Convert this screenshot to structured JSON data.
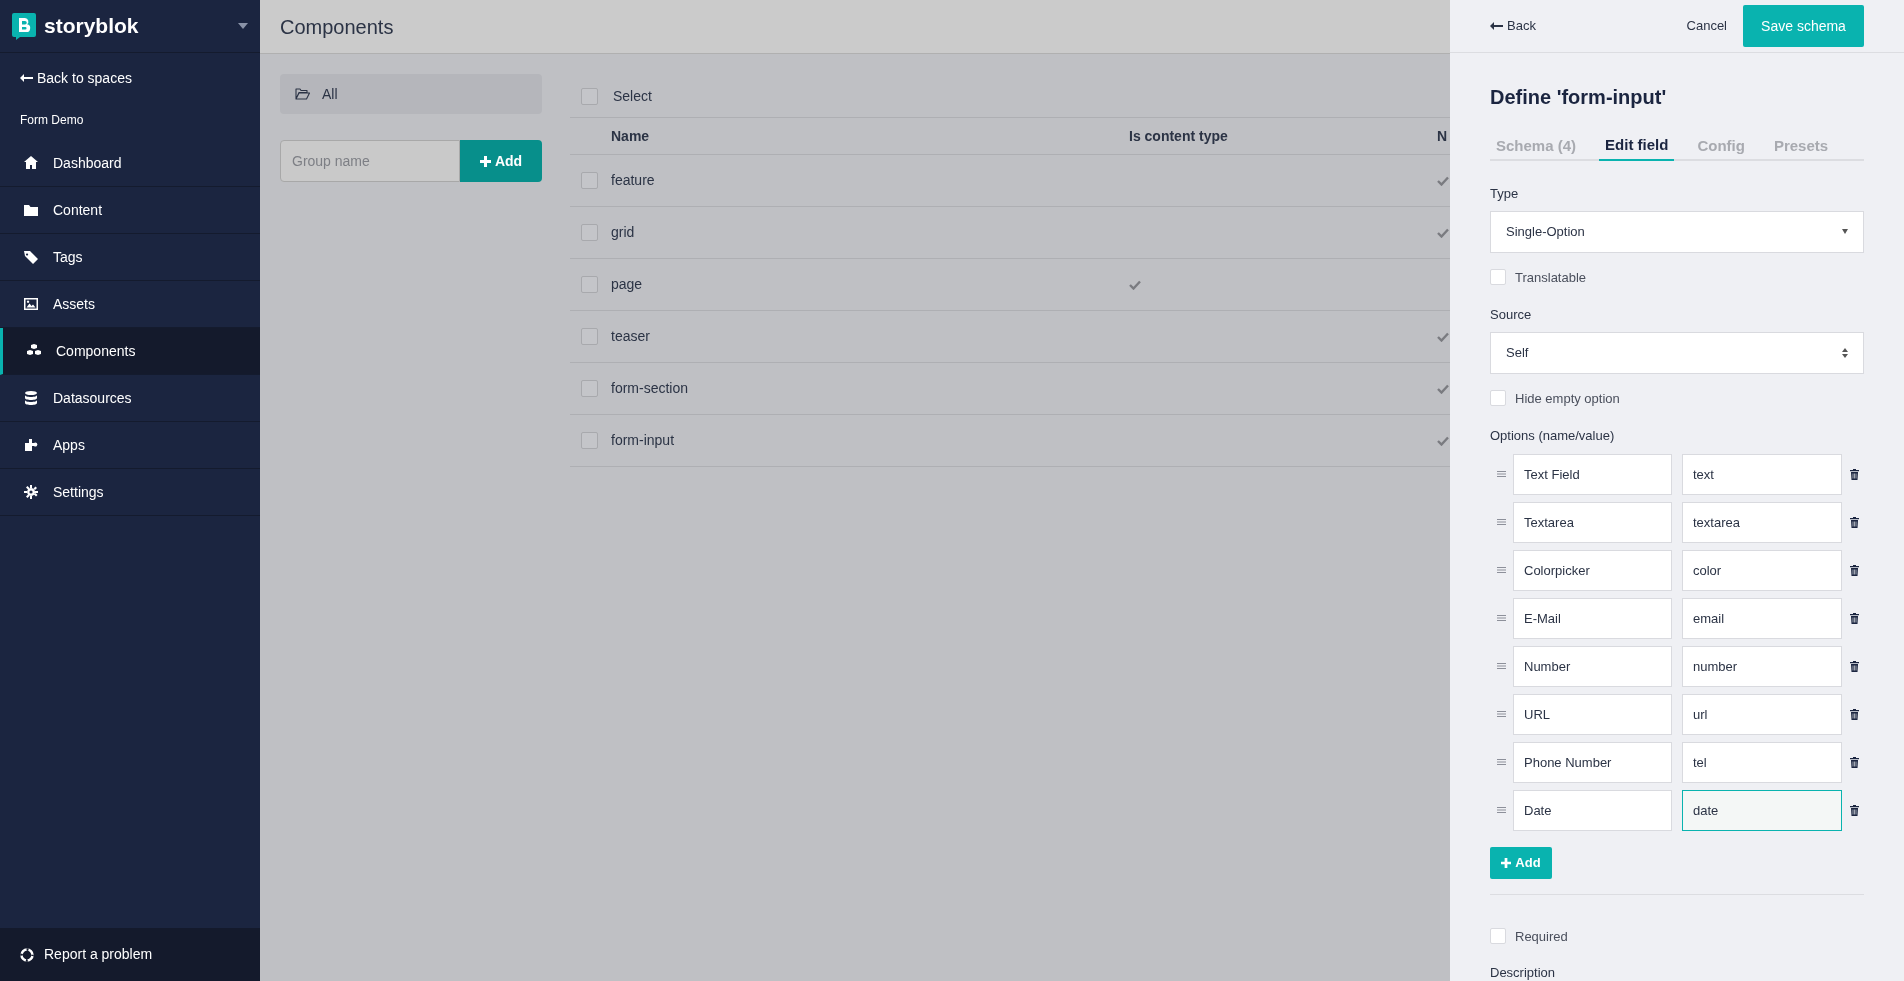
{
  "sidebar": {
    "brand": "storyblok",
    "back": "Back to spaces",
    "space": "Form Demo",
    "items": [
      {
        "label": "Dashboard",
        "selected": false
      },
      {
        "label": "Content",
        "selected": false
      },
      {
        "label": "Tags",
        "selected": false
      },
      {
        "label": "Assets",
        "selected": false
      },
      {
        "label": "Components",
        "selected": true
      },
      {
        "label": "Datasources",
        "selected": false
      },
      {
        "label": "Apps",
        "selected": false
      },
      {
        "label": "Settings",
        "selected": false
      }
    ],
    "footer": "Report a problem"
  },
  "main": {
    "title": "Components",
    "groups": [
      {
        "label": "All",
        "selected": true
      }
    ],
    "group_input": {
      "placeholder": "Group name"
    },
    "add_button": "Add",
    "table": {
      "select_label": "Select",
      "select_checked": false,
      "columns": [
        "Name",
        "Is content type",
        "N"
      ],
      "rows": [
        {
          "name": "feature",
          "checked": false,
          "is_content_type": false,
          "column_3": true
        },
        {
          "name": "grid",
          "checked": false,
          "is_content_type": false,
          "column_3": true
        },
        {
          "name": "page",
          "checked": false,
          "is_content_type": true,
          "column_3": false
        },
        {
          "name": "teaser",
          "checked": false,
          "is_content_type": false,
          "column_3": true
        },
        {
          "name": "form-section",
          "checked": false,
          "is_content_type": false,
          "column_3": true
        },
        {
          "name": "form-input",
          "checked": false,
          "is_content_type": false,
          "column_3": true
        }
      ]
    }
  },
  "panel": {
    "back": "Back",
    "cancel": "Cancel",
    "save": "Save schema",
    "title": "Define 'form-input'",
    "tabs": [
      {
        "label": "Schema (4)",
        "selected": false
      },
      {
        "label": "Edit field",
        "selected": true
      },
      {
        "label": "Config",
        "selected": false
      },
      {
        "label": "Presets",
        "selected": false
      }
    ],
    "type_label": "Type",
    "type_value": "Single-Option",
    "translatable": {
      "label": "Translatable",
      "checked": false
    },
    "source_label": "Source",
    "source_value": "Self",
    "hide_empty": {
      "label": "Hide empty option",
      "checked": false
    },
    "options_label": "Options (name/value)",
    "options": [
      {
        "name": "Text Field",
        "value": "text",
        "focused": false
      },
      {
        "name": "Textarea",
        "value": "textarea",
        "focused": false
      },
      {
        "name": "Colorpicker",
        "value": "color",
        "focused": false
      },
      {
        "name": "E-Mail",
        "value": "email",
        "focused": false
      },
      {
        "name": "Number",
        "value": "number",
        "focused": false
      },
      {
        "name": "URL",
        "value": "url",
        "focused": false
      },
      {
        "name": "Phone Number",
        "value": "tel",
        "focused": false
      },
      {
        "name": "Date",
        "value": "date",
        "focused": true
      }
    ],
    "add_button": "Add",
    "required": {
      "label": "Required",
      "checked": false
    },
    "description_label": "Description"
  }
}
